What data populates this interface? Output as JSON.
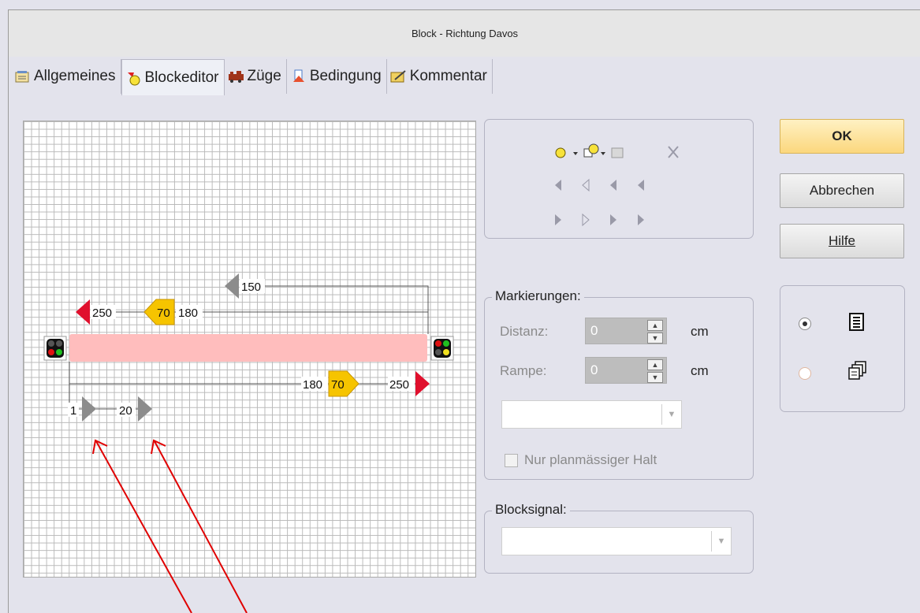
{
  "window": {
    "title": "Block - Richtung Davos"
  },
  "tabs": [
    {
      "label": "Allgemeines"
    },
    {
      "label": "Blockeditor"
    },
    {
      "label": "Züge"
    },
    {
      "label": "Bedingung"
    },
    {
      "label": "Kommentar"
    }
  ],
  "editor": {
    "markers_top": [
      {
        "label": "150",
        "color": "#8c8c8c"
      },
      {
        "label": "250",
        "color": "#e0102d"
      },
      {
        "label": "70",
        "color": "#f6c400"
      },
      {
        "label": "180",
        "color": "#000000"
      }
    ],
    "markers_bottom": [
      {
        "label": "180",
        "color": "#000000"
      },
      {
        "label": "70",
        "color": "#f6c400"
      },
      {
        "label": "250",
        "color": "#e0102d"
      }
    ],
    "stop_markers": [
      {
        "label": "1"
      },
      {
        "label": "20"
      }
    ],
    "block_color": "#ffbdbd"
  },
  "buttons": {
    "ok": "OK",
    "cancel": "Abbrechen",
    "help": "Hilfe"
  },
  "markierungen": {
    "title": "Markierungen:",
    "distanz_label": "Distanz:",
    "distanz_value": "0",
    "distanz_unit": "cm",
    "rampe_label": "Rampe:",
    "rampe_value": "0",
    "rampe_unit": "cm",
    "combo_value": "",
    "checkbox_label": "Nur planmässiger Halt"
  },
  "blocksignal": {
    "title": "Blocksignal:",
    "combo_value": ""
  },
  "view_mode": {
    "selected": "list"
  }
}
